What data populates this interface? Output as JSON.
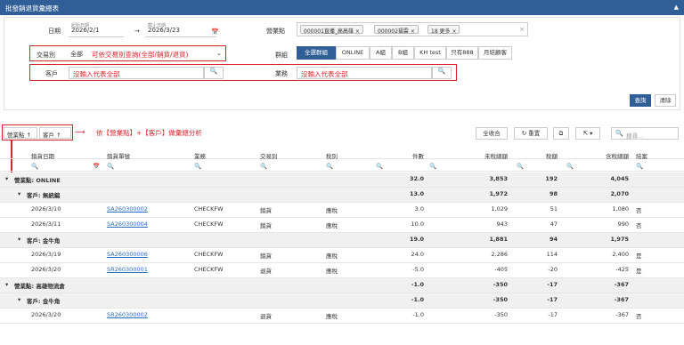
{
  "title": "批發銷退貨彙總表",
  "filters": {
    "date_label": "日期",
    "date_start_caption": "起始日期",
    "date_start": "2026/2/1",
    "date_end_caption": "截止日期",
    "date_end": "2026/3/23",
    "date_arrow": "→",
    "store_label": "營業點",
    "store_chips": [
      "000001直播_高高雄",
      "000002福雲",
      "18 更多"
    ],
    "txn_label": "交易別",
    "txn_value": "全部",
    "txn_note": "可依交易別查詢(全部/銷貨/退貨)",
    "group_label": "群組",
    "group_buttons": [
      "全選群組",
      "ONLINE",
      "A組",
      "B組",
      "KH test",
      "只有888",
      "月結顧客"
    ],
    "customer_label": "客戶",
    "customer_placeholder": "沒輸入代表全部",
    "sales_label": "業務",
    "sales_placeholder": "沒輸入代表全部",
    "query_btn": "查詢",
    "clear_btn": "清除"
  },
  "groupbar": {
    "chip1": "營業點 ↑",
    "chip2": "客戶 ↑",
    "annotation": "依【營業點】+【客戶】做彙總分析",
    "collapse_btn": "全收合",
    "reset_btn": "重置",
    "search_placeholder": "搜尋..."
  },
  "columns": [
    "銷貨日期",
    "銷貨單號",
    "業務",
    "交易別",
    "稅別",
    "件數",
    "未稅總額",
    "稅額",
    "含稅總額",
    "結案"
  ],
  "rows": [
    {
      "kind": "g1",
      "label": "營業點: ONLINE",
      "qty": "32.0",
      "pre": "3,853",
      "tax": "192",
      "total": "4,045"
    },
    {
      "kind": "g2",
      "label": "客戶: 無統編",
      "qty": "13.0",
      "pre": "1,972",
      "tax": "98",
      "total": "2,070"
    },
    {
      "kind": "d",
      "date": "2026/3/10",
      "no": "SA260300002",
      "rep": "CHECKFW",
      "type": "銷貨",
      "taxkind": "應稅",
      "qty": "3.0",
      "pre": "1,029",
      "tax": "51",
      "total": "1,080",
      "closed": "否"
    },
    {
      "kind": "d",
      "date": "2026/3/11",
      "no": "SA260300004",
      "rep": "CHECKFW",
      "type": "銷貨",
      "taxkind": "應稅",
      "qty": "10.0",
      "pre": "943",
      "tax": "47",
      "total": "990",
      "closed": "否"
    },
    {
      "kind": "g2",
      "label": "客戶: 金牛角",
      "qty": "19.0",
      "pre": "1,881",
      "tax": "94",
      "total": "1,975"
    },
    {
      "kind": "d",
      "date": "2026/3/19",
      "no": "SA260300006",
      "rep": "CHECKFW",
      "type": "銷貨",
      "taxkind": "應稅",
      "qty": "24.0",
      "pre": "2,286",
      "tax": "114",
      "total": "2,400",
      "closed": "是"
    },
    {
      "kind": "d",
      "date": "2026/3/20",
      "no": "SR260300001",
      "rep": "CHECKFW",
      "type": "退貨",
      "taxkind": "應稅",
      "qty": "-5.0",
      "pre": "-405",
      "tax": "-20",
      "total": "-425",
      "closed": "是"
    },
    {
      "kind": "g1",
      "label": "營業點: 高雄物流倉",
      "qty": "-1.0",
      "pre": "-350",
      "tax": "-17",
      "total": "-367"
    },
    {
      "kind": "g2",
      "label": "客戶: 金牛角",
      "qty": "-1.0",
      "pre": "-350",
      "tax": "-17",
      "total": "-367"
    },
    {
      "kind": "d",
      "date": "2026/3/20",
      "no": "SR260300002",
      "rep": "",
      "type": "退貨",
      "taxkind": "應稅",
      "qty": "-1.0",
      "pre": "-350",
      "tax": "-17",
      "total": "-367",
      "closed": "否"
    }
  ],
  "colors": {
    "header": "#2f5f96",
    "accent_red": "#d9232d",
    "link": "#2a6ebc"
  }
}
